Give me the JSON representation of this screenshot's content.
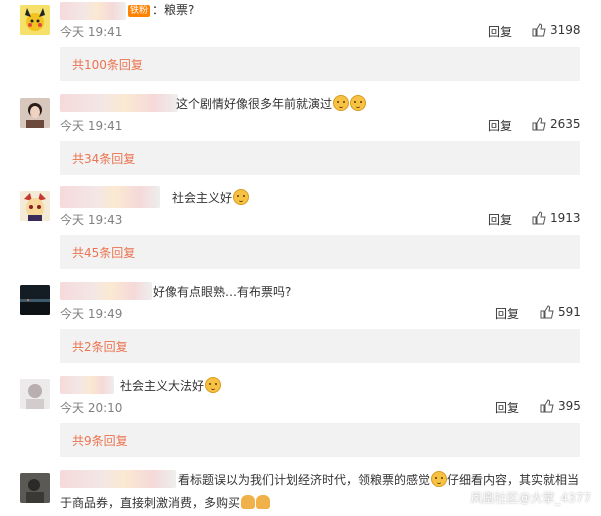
{
  "comments": [
    {
      "text": "：粮票?",
      "time": "今天 19:41",
      "reply": "回复",
      "likes": "3198",
      "sub": "共100条回复",
      "badge": "铁粉",
      "emoji": []
    },
    {
      "text": "这个剧情好像很多年前就演过",
      "time": "今天 19:41",
      "reply": "回复",
      "likes": "2635",
      "sub": "共34条回复",
      "emoji": [
        "doge-emoji",
        "doge-emoji"
      ]
    },
    {
      "text": "社会主义好",
      "time": "今天 19:43",
      "reply": "回复",
      "likes": "1913",
      "sub": "共45条回复",
      "emoji": [
        "doge-emoji"
      ]
    },
    {
      "text": "好像有点眼熟…有布票吗?",
      "time": "今天 19:49",
      "reply": "回复",
      "likes": "591",
      "sub": "共2条回复",
      "emoji": []
    },
    {
      "text": "社会主义大法好",
      "time": "今天 20:10",
      "reply": "回复",
      "likes": "395",
      "sub": "共9条回复",
      "emoji": [
        "doge-emoji"
      ]
    },
    {
      "text_line1a": "看标题误以为我们计划经济时代，领粮票的感觉",
      "text_line1b": "仔细看内容，其实就相当",
      "text_line2": "于商品券，直接刺激消费，多购买",
      "emoji": [
        "doge-emoji",
        "pray-emoji",
        "pray-emoji"
      ]
    }
  ],
  "watermark": "凤凰社区@大掌_4377",
  "icons": {
    "like": "thumbs-up-icon"
  }
}
